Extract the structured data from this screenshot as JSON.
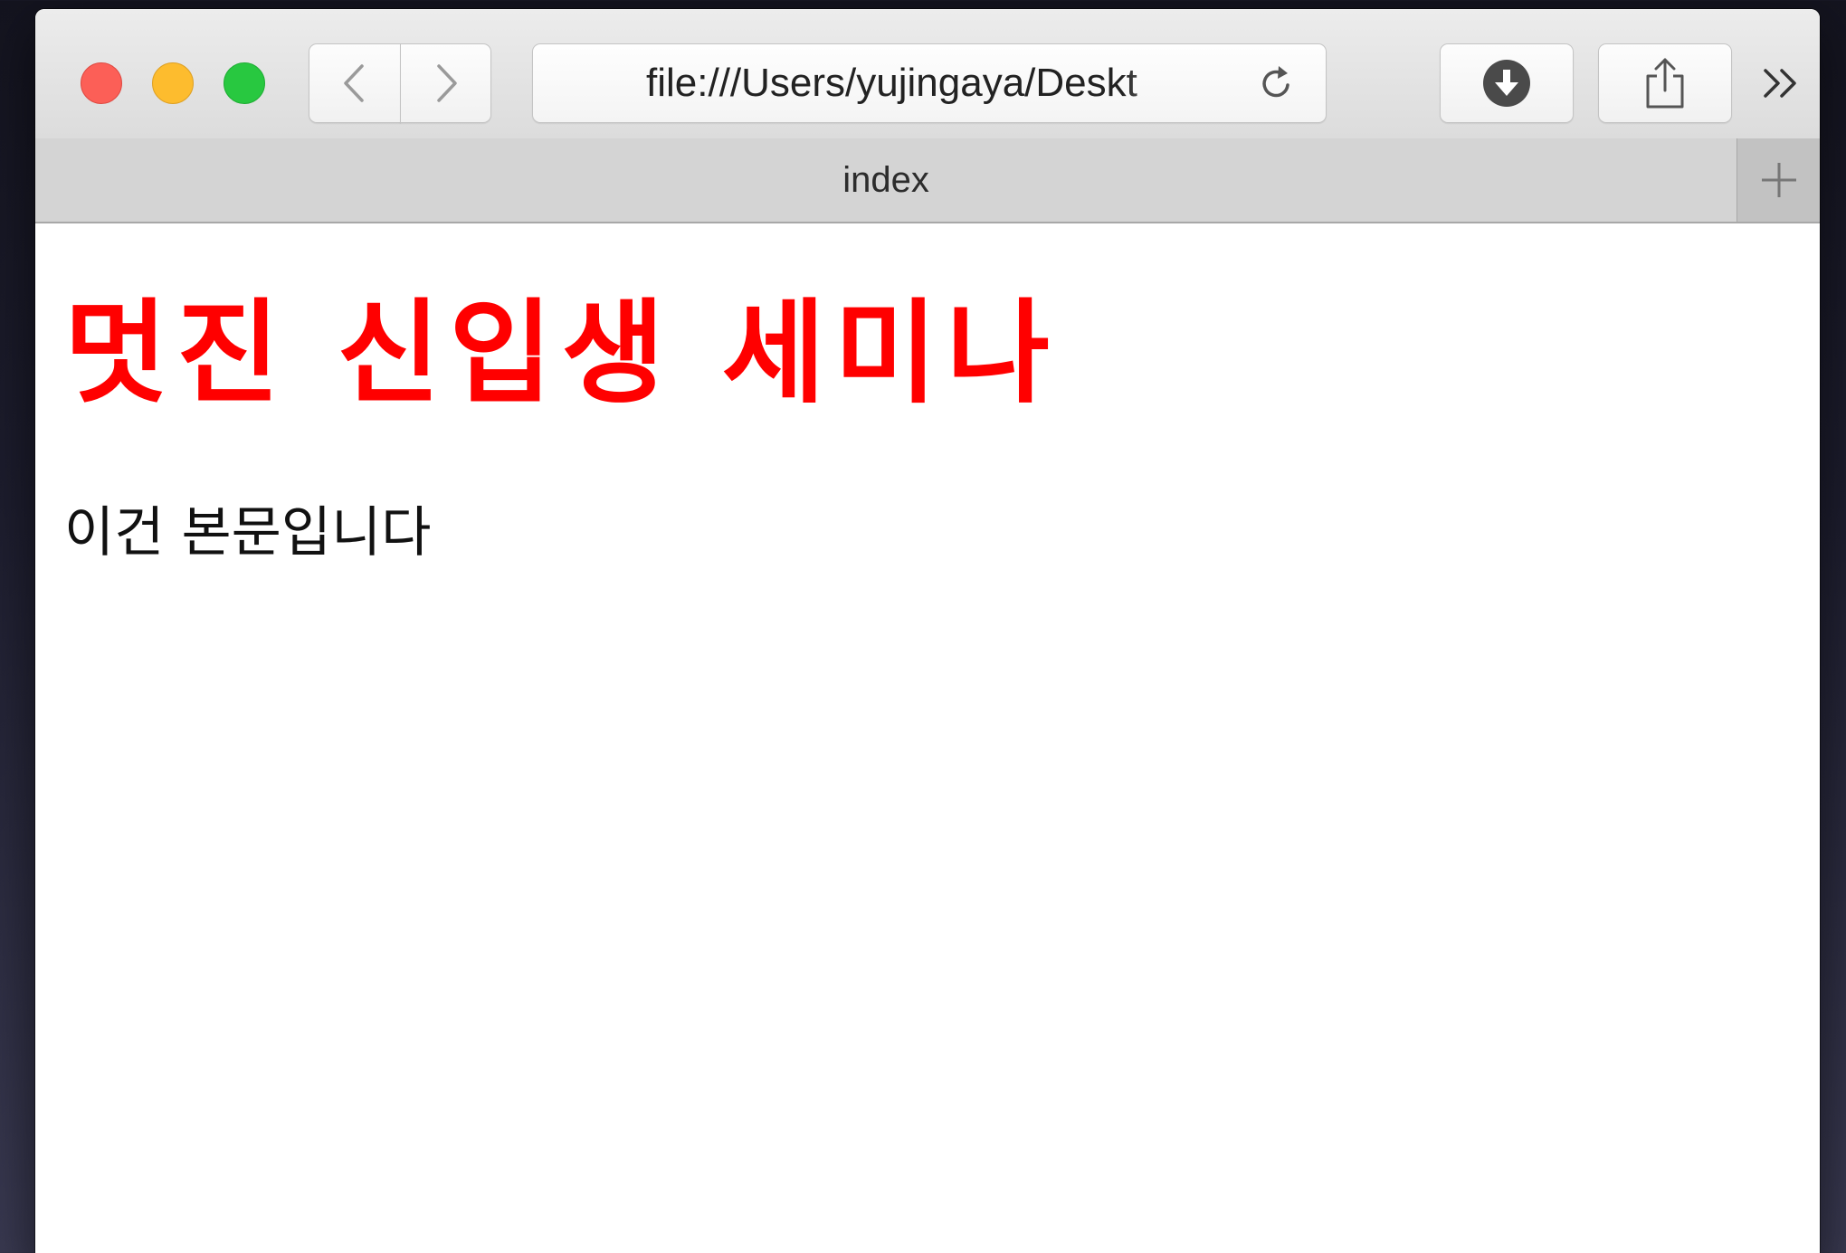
{
  "browser": {
    "address_bar": {
      "url": "file:///Users/yujingaya/Deskt"
    },
    "tabs": [
      {
        "title": "index"
      }
    ],
    "icons": {
      "close": "close-icon",
      "minimize": "minimize-icon",
      "zoom": "zoom-icon",
      "back": "chevron-left-icon",
      "forward": "chevron-right-icon",
      "reload": "reload-icon",
      "downloads": "download-icon",
      "share": "share-icon",
      "overflow": "double-chevron-right-icon",
      "new_tab": "plus-icon"
    },
    "colors": {
      "close": "#fc5f57",
      "minimize": "#fdbc2e",
      "zoom": "#28c840"
    }
  },
  "page": {
    "heading": "멋진 신입생 세미나",
    "heading_color": "#ff0000",
    "body": "이건 본문입니다"
  }
}
